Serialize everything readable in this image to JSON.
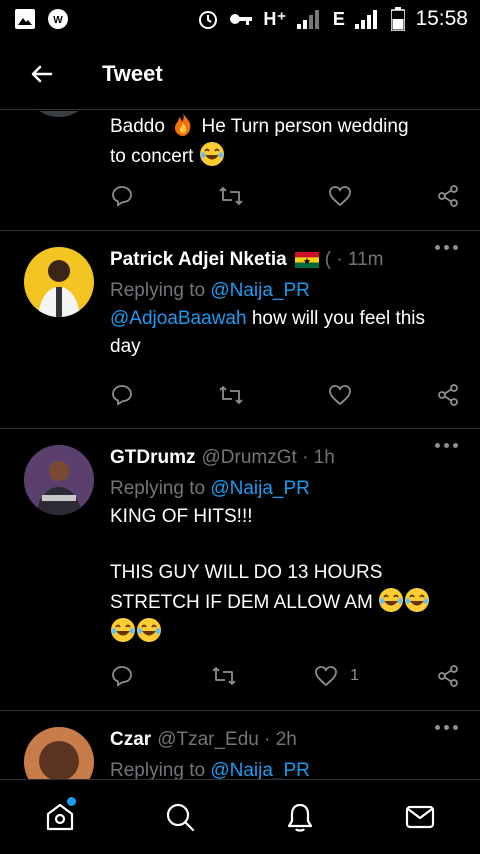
{
  "status_bar": {
    "network": "H⁺",
    "network2": "E",
    "time": "15:58"
  },
  "header": {
    "title": "Tweet"
  },
  "tweets": [
    {
      "text_line1": "Baddo",
      "text_line1b": "He Turn person wedding",
      "text_line2": "to concert"
    },
    {
      "name": "Patrick Adjei Nketia",
      "meta": "( · 11m",
      "replying": "Replying to",
      "reply_handle": "@Naija_PR",
      "mention": "@AdjoaBaawah",
      "text_a": " how will you feel this",
      "text_b": "day"
    },
    {
      "name": "GTDrumz",
      "handle": "@DrumzGt · 1h",
      "replying": "Replying to",
      "reply_handle": "@Naija_PR",
      "line1": "KING OF HITS!!!",
      "line2": "THIS GUY WILL DO 13 HOURS",
      "line3": "STRETCH IF DEM ALLOW AM",
      "like_count": "1"
    },
    {
      "name": "Czar",
      "handle": "@Tzar_Edu · 2h",
      "replying": "Replying to",
      "reply_handle": "@Naija_PR"
    }
  ],
  "colors": {
    "accent": "#1d9bf0",
    "muted": "#71767b",
    "divider": "#2f3336"
  },
  "icons": [
    "image-icon",
    "whatsapp-icon",
    "alarm-icon",
    "key-icon",
    "signal-icon",
    "battery-icon",
    "back-arrow-icon",
    "reply-icon",
    "retweet-icon",
    "like-icon",
    "share-icon",
    "more-icon",
    "home-icon",
    "search-icon",
    "notifications-icon",
    "messages-icon",
    "fire-emoji",
    "laughing-emoji",
    "ghana-flag-icon"
  ]
}
